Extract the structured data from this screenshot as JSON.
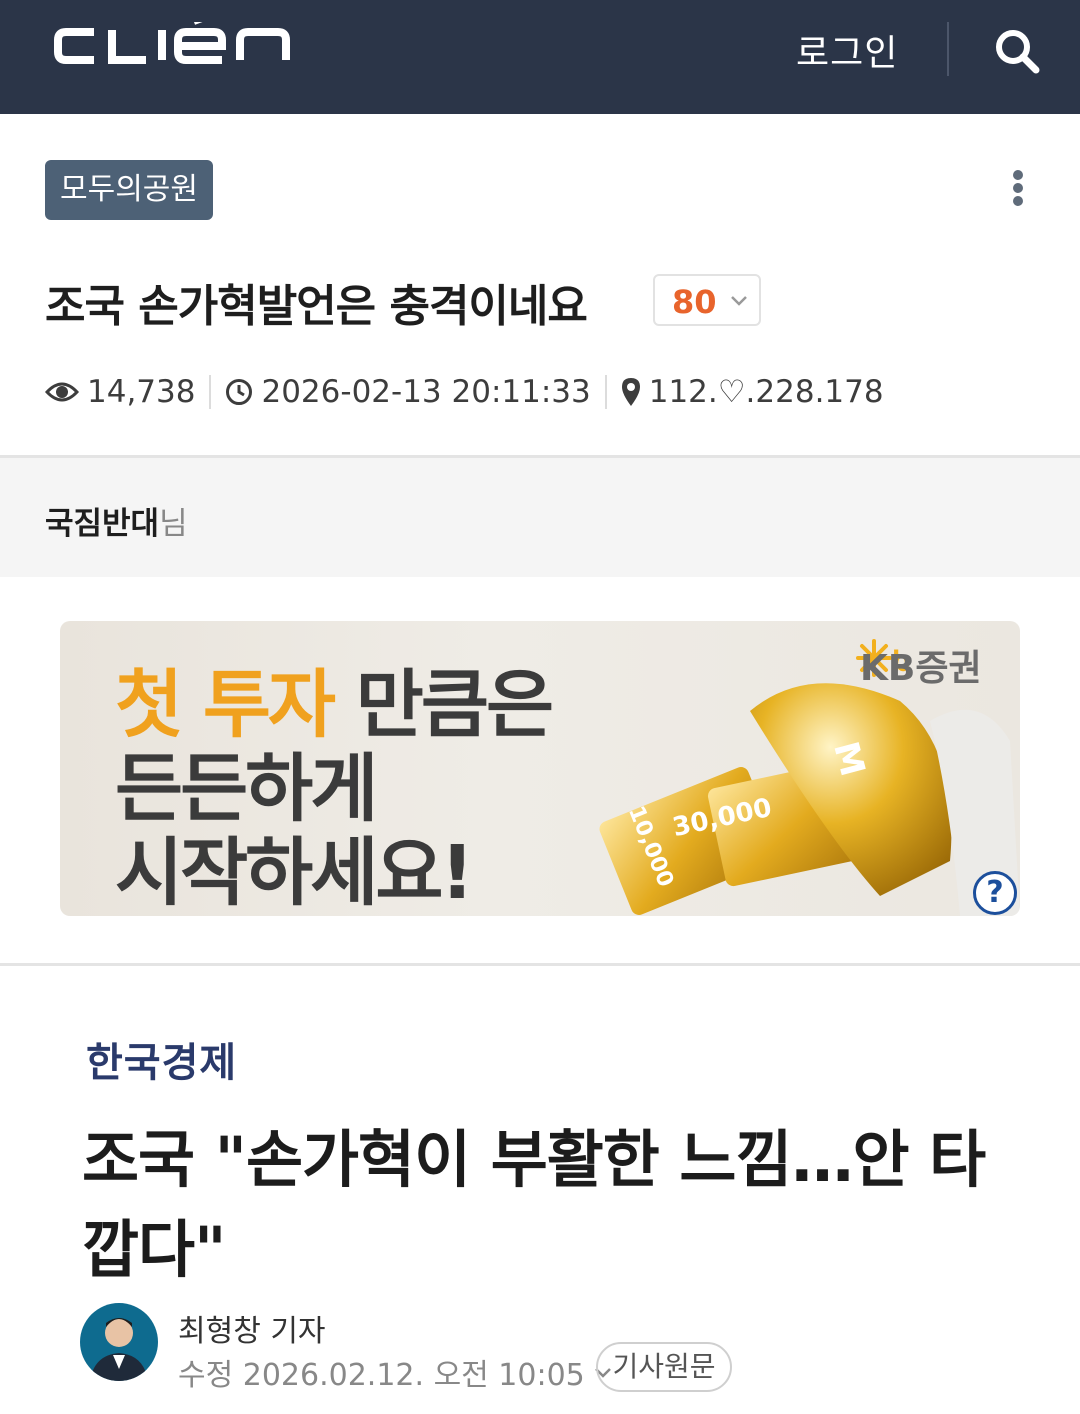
{
  "header": {
    "logo_text": "CLIEN",
    "login_label": "로그인",
    "search_icon": "search-icon",
    "background": "#2b3548"
  },
  "post": {
    "board": "모두의공원",
    "title": "조국 손가혁발언은 충격이네요",
    "comment_count": "80",
    "views": "14,738",
    "datetime": "2026-02-13 20:11:33",
    "ip": "112.♡.228.178",
    "author": "국짐반대",
    "author_suffix": "님"
  },
  "ad": {
    "line1_highlight": "첫 투자",
    "line1_rest": " 만큼은",
    "line2": "든든하게",
    "line3": "시작하세요!",
    "brand": "KB증권",
    "card_front_value": "10,000",
    "card_back_value": "30,000",
    "dome_letter": "M",
    "help_label": "?",
    "accent_color": "#f0a11e"
  },
  "article": {
    "press": "한국경제",
    "headline": "조국 \"손가혁이 부활한 느낌…안 타깝다\"",
    "reporter": "최형창 기자",
    "updated_label": "수정 2026.02.12. 오전 10:05",
    "original_button": "기사원문"
  },
  "colors": {
    "board_tag": "#4d6176",
    "comment_count": "#e8642c",
    "press": "#2a3a6b"
  }
}
